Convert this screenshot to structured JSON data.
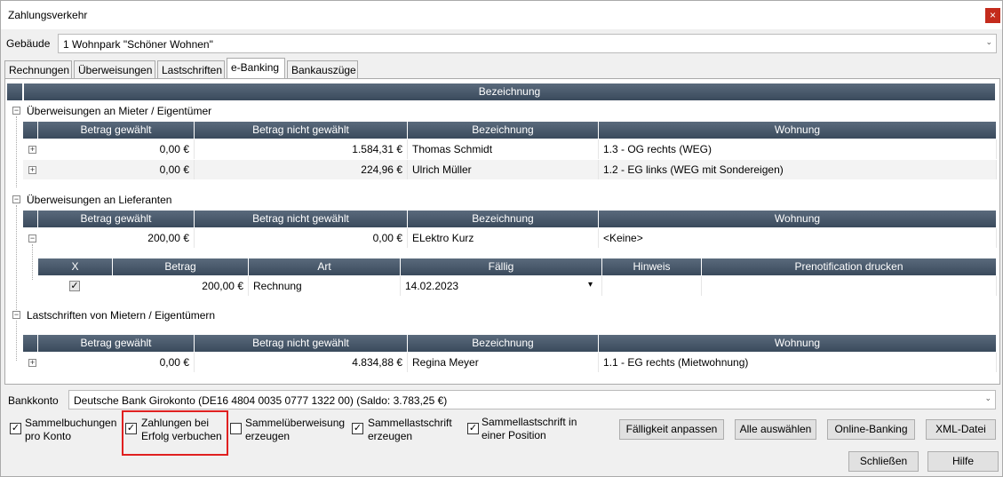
{
  "window": {
    "title": "Zahlungsverkehr",
    "close_glyph": "×"
  },
  "gebaeude": {
    "label": "Gebäude",
    "value": "1 Wohnpark \"Schöner Wohnen\""
  },
  "tabs": [
    "Rechnungen",
    "Überweisungen",
    "Lastschriften",
    "e-Banking",
    "Bankauszüge"
  ],
  "active_tab": "e-Banking",
  "grid": {
    "top_header": "Bezeichnung",
    "columns": [
      "Betrag gewählt",
      "Betrag nicht gewählt",
      "Bezeichnung",
      "Wohnung"
    ],
    "groups": [
      {
        "title": "Überweisungen an Mieter / Eigentümer",
        "rows": [
          {
            "gewaehlt": "0,00 €",
            "nicht_gewaehlt": "1.584,31 €",
            "bezeichnung": "Thomas Schmidt",
            "wohnung": "1.3 - OG rechts (WEG)"
          },
          {
            "gewaehlt": "0,00 €",
            "nicht_gewaehlt": "224,96 €",
            "bezeichnung": "Ulrich Müller",
            "wohnung": "1.2 - EG links (WEG mit Sondereigen)"
          }
        ]
      },
      {
        "title": "Überweisungen an Lieferanten",
        "rows": [
          {
            "gewaehlt": "200,00 €",
            "nicht_gewaehlt": "0,00 €",
            "bezeichnung": "ELektro Kurz",
            "wohnung": "<Keine>"
          }
        ],
        "detail_columns": [
          "X",
          "Betrag",
          "Art",
          "Fällig",
          "Hinweis",
          "Prenotification drucken"
        ],
        "detail_rows": [
          {
            "checked": true,
            "betrag": "200,00 €",
            "art": "Rechnung",
            "faellig": "14.02.2023",
            "hinweis": "",
            "prenotification": ""
          }
        ]
      },
      {
        "title": "Lastschriften von Mietern / Eigentümern",
        "rows": [
          {
            "gewaehlt": "0,00 €",
            "nicht_gewaehlt": "4.834,88 €",
            "bezeichnung": "Regina Meyer",
            "wohnung": "1.1 - EG rechts (Mietwohnung)"
          }
        ]
      }
    ]
  },
  "bankkonto": {
    "label": "Bankkonto",
    "value": "Deutsche Bank Girokonto (DE16 4804 0035 0777 1322 00) (Saldo: 3.783,25 €)"
  },
  "options": [
    {
      "line1": "Sammelbuchungen",
      "line2": "pro Konto",
      "checked": true
    },
    {
      "line1": "Zahlungen bei",
      "line2": "Erfolg verbuchen",
      "checked": true
    },
    {
      "line1": "Sammelüberweisung",
      "line2": "erzeugen",
      "checked": false
    },
    {
      "line1": "Sammellastschrift",
      "line2": "erzeugen",
      "checked": true
    },
    {
      "line1": "Sammellastschrift in",
      "line2": "einer Position",
      "checked": true
    }
  ],
  "buttons": {
    "faelligkeit": "Fälligkeit anpassen",
    "alle": "Alle auswählen",
    "online": "Online-Banking",
    "xml": "XML-Datei",
    "schliessen": "Schließen",
    "hilfe": "Hilfe"
  },
  "glyphs": {
    "check": "✓",
    "plus": "+",
    "minus": "−",
    "dropdown": "⌄",
    "dropdown_filled": "▾"
  },
  "colors": {
    "header_bg": "#3f4f61",
    "highlight_border": "#e02020",
    "close_bg": "#c42b1c"
  }
}
